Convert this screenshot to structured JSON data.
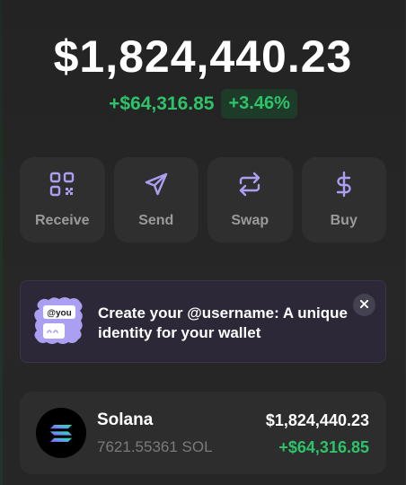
{
  "balance": {
    "total": "$1,824,440.23",
    "change_usd": "+$64,316.85",
    "change_pct": "+3.46%"
  },
  "actions": [
    {
      "label": "Receive",
      "icon": "qr-code-icon"
    },
    {
      "label": "Send",
      "icon": "send-icon"
    },
    {
      "label": "Swap",
      "icon": "swap-icon"
    },
    {
      "label": "Buy",
      "icon": "dollar-icon"
    }
  ],
  "banner": {
    "art_tag": "@you",
    "text": "Create your @username: A unique identity for your wallet",
    "close_icon": "close-icon"
  },
  "tokens": [
    {
      "name": "Solana",
      "amount": "7621.55361 SOL",
      "value": "$1,824,440.23",
      "change": "+$64,316.85",
      "icon": "solana-logo-icon"
    }
  ],
  "colors": {
    "background": "#252525",
    "card": "#2f2f2f",
    "accent": "#ab9ff2",
    "positive": "#2ec36a",
    "banner_bg": "#2c2838"
  }
}
